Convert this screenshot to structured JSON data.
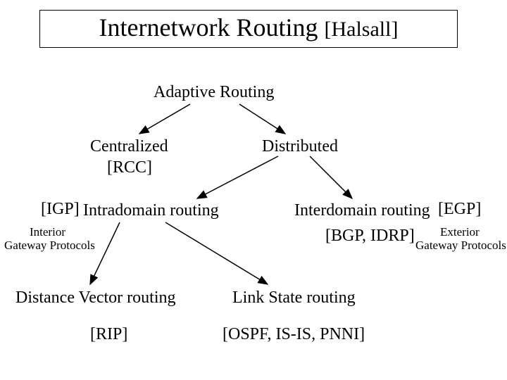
{
  "title": {
    "main": "Internetwork Routing ",
    "ref": "[Halsall]"
  },
  "nodes": {
    "adaptive": "Adaptive Routing",
    "centralized_l1": "Centralized",
    "centralized_l2": "[RCC]",
    "distributed": "Distributed",
    "igp_tag": "[IGP]",
    "intradomain": "Intradomain routing",
    "interdomain": "Interdomain routing",
    "egp_tag": "[EGP]",
    "igp_full_l1": "Interior",
    "igp_full_l2": "Gateway Protocols",
    "egp_full_l1": "Exterior",
    "egp_full_l2": "Gateway Protocols",
    "bgp": "[BGP, IDRP]",
    "dv": "Distance Vector routing",
    "ls": "Link State routing",
    "rip": "[RIP]",
    "ospf": "[OSPF, IS-IS, PNNI]"
  }
}
